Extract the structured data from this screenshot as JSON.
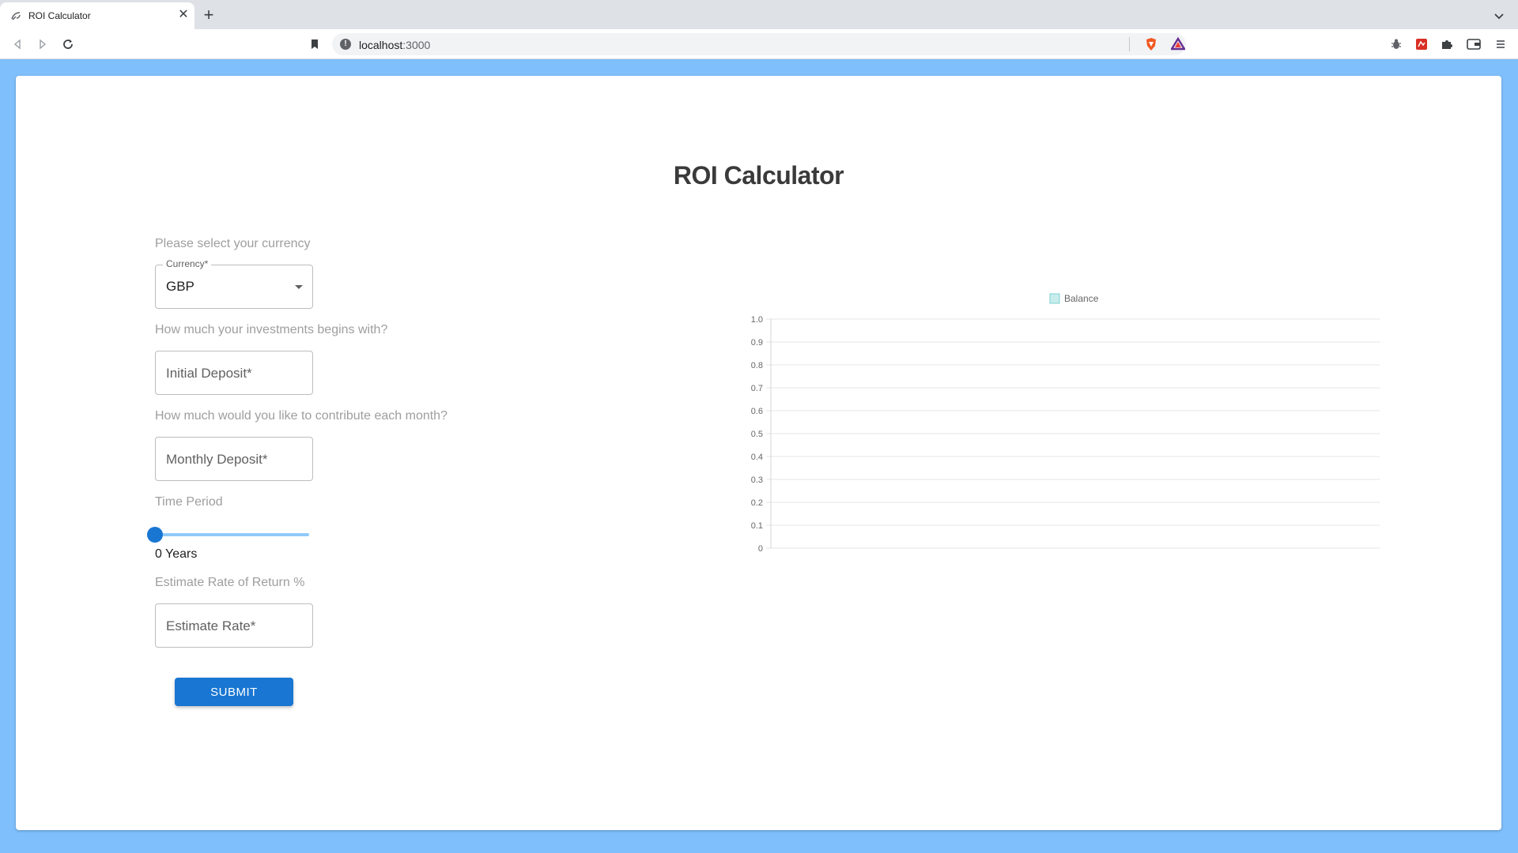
{
  "browser": {
    "tab_title": "ROI Calculator",
    "url_host": "localhost",
    "url_port": ":3000"
  },
  "page": {
    "title": "ROI Calculator"
  },
  "form": {
    "currency_question": "Please select your currency",
    "currency_label": "Currency*",
    "currency_value": "GBP",
    "initial_question": "How much your investments begins with?",
    "initial_placeholder": "Initial Deposit*",
    "monthly_question": "How much would you like to contribute each month?",
    "monthly_placeholder": "Monthly Deposit*",
    "time_label": "Time Period",
    "time_value": 0,
    "time_value_text": "0 Years",
    "rate_question": "Estimate Rate of Return %",
    "rate_placeholder": "Estimate Rate*",
    "submit_label": "SUBMIT"
  },
  "colors": {
    "accent": "#1976d2",
    "slider_track": "#90caf9",
    "page_background": "#7fbffc",
    "legend_swatch_fill": "#c8ecec",
    "legend_swatch_border": "#7fd2d2"
  },
  "icons": {
    "back": "arrow-left-icon",
    "forward": "arrow-right-icon",
    "reload": "reload-icon",
    "bookmark": "bookmark-icon",
    "site_info": "info-icon",
    "brave": "brave-shield-icon",
    "rewards": "brave-rewards-icon",
    "extensions": "puzzle-icon",
    "wallet": "wallet-icon",
    "menu": "hamburger-menu-icon"
  },
  "chart_data": {
    "type": "bar",
    "categories": [],
    "series": [
      {
        "name": "Balance",
        "values": []
      }
    ],
    "ylim": [
      0,
      1.0
    ],
    "yticks": [
      "0",
      "0.1",
      "0.2",
      "0.3",
      "0.4",
      "0.5",
      "0.6",
      "0.7",
      "0.8",
      "0.9",
      "1.0"
    ],
    "grid": true,
    "legend": "top-center"
  }
}
